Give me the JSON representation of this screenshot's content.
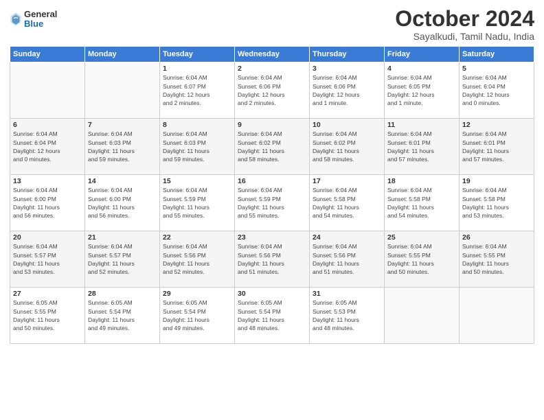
{
  "header": {
    "logo_general": "General",
    "logo_blue": "Blue",
    "month_title": "October 2024",
    "subtitle": "Sayalkudi, Tamil Nadu, India"
  },
  "weekdays": [
    "Sunday",
    "Monday",
    "Tuesday",
    "Wednesday",
    "Thursday",
    "Friday",
    "Saturday"
  ],
  "weeks": [
    [
      {
        "day": "",
        "info": ""
      },
      {
        "day": "",
        "info": ""
      },
      {
        "day": "1",
        "info": "Sunrise: 6:04 AM\nSunset: 6:07 PM\nDaylight: 12 hours\nand 2 minutes."
      },
      {
        "day": "2",
        "info": "Sunrise: 6:04 AM\nSunset: 6:06 PM\nDaylight: 12 hours\nand 2 minutes."
      },
      {
        "day": "3",
        "info": "Sunrise: 6:04 AM\nSunset: 6:06 PM\nDaylight: 12 hours\nand 1 minute."
      },
      {
        "day": "4",
        "info": "Sunrise: 6:04 AM\nSunset: 6:05 PM\nDaylight: 12 hours\nand 1 minute."
      },
      {
        "day": "5",
        "info": "Sunrise: 6:04 AM\nSunset: 6:04 PM\nDaylight: 12 hours\nand 0 minutes."
      }
    ],
    [
      {
        "day": "6",
        "info": "Sunrise: 6:04 AM\nSunset: 6:04 PM\nDaylight: 12 hours\nand 0 minutes."
      },
      {
        "day": "7",
        "info": "Sunrise: 6:04 AM\nSunset: 6:03 PM\nDaylight: 11 hours\nand 59 minutes."
      },
      {
        "day": "8",
        "info": "Sunrise: 6:04 AM\nSunset: 6:03 PM\nDaylight: 11 hours\nand 59 minutes."
      },
      {
        "day": "9",
        "info": "Sunrise: 6:04 AM\nSunset: 6:02 PM\nDaylight: 11 hours\nand 58 minutes."
      },
      {
        "day": "10",
        "info": "Sunrise: 6:04 AM\nSunset: 6:02 PM\nDaylight: 11 hours\nand 58 minutes."
      },
      {
        "day": "11",
        "info": "Sunrise: 6:04 AM\nSunset: 6:01 PM\nDaylight: 11 hours\nand 57 minutes."
      },
      {
        "day": "12",
        "info": "Sunrise: 6:04 AM\nSunset: 6:01 PM\nDaylight: 11 hours\nand 57 minutes."
      }
    ],
    [
      {
        "day": "13",
        "info": "Sunrise: 6:04 AM\nSunset: 6:00 PM\nDaylight: 11 hours\nand 56 minutes."
      },
      {
        "day": "14",
        "info": "Sunrise: 6:04 AM\nSunset: 6:00 PM\nDaylight: 11 hours\nand 56 minutes."
      },
      {
        "day": "15",
        "info": "Sunrise: 6:04 AM\nSunset: 5:59 PM\nDaylight: 11 hours\nand 55 minutes."
      },
      {
        "day": "16",
        "info": "Sunrise: 6:04 AM\nSunset: 5:59 PM\nDaylight: 11 hours\nand 55 minutes."
      },
      {
        "day": "17",
        "info": "Sunrise: 6:04 AM\nSunset: 5:58 PM\nDaylight: 11 hours\nand 54 minutes."
      },
      {
        "day": "18",
        "info": "Sunrise: 6:04 AM\nSunset: 5:58 PM\nDaylight: 11 hours\nand 54 minutes."
      },
      {
        "day": "19",
        "info": "Sunrise: 6:04 AM\nSunset: 5:58 PM\nDaylight: 11 hours\nand 53 minutes."
      }
    ],
    [
      {
        "day": "20",
        "info": "Sunrise: 6:04 AM\nSunset: 5:57 PM\nDaylight: 11 hours\nand 53 minutes."
      },
      {
        "day": "21",
        "info": "Sunrise: 6:04 AM\nSunset: 5:57 PM\nDaylight: 11 hours\nand 52 minutes."
      },
      {
        "day": "22",
        "info": "Sunrise: 6:04 AM\nSunset: 5:56 PM\nDaylight: 11 hours\nand 52 minutes."
      },
      {
        "day": "23",
        "info": "Sunrise: 6:04 AM\nSunset: 5:56 PM\nDaylight: 11 hours\nand 51 minutes."
      },
      {
        "day": "24",
        "info": "Sunrise: 6:04 AM\nSunset: 5:56 PM\nDaylight: 11 hours\nand 51 minutes."
      },
      {
        "day": "25",
        "info": "Sunrise: 6:04 AM\nSunset: 5:55 PM\nDaylight: 11 hours\nand 50 minutes."
      },
      {
        "day": "26",
        "info": "Sunrise: 6:04 AM\nSunset: 5:55 PM\nDaylight: 11 hours\nand 50 minutes."
      }
    ],
    [
      {
        "day": "27",
        "info": "Sunrise: 6:05 AM\nSunset: 5:55 PM\nDaylight: 11 hours\nand 50 minutes."
      },
      {
        "day": "28",
        "info": "Sunrise: 6:05 AM\nSunset: 5:54 PM\nDaylight: 11 hours\nand 49 minutes."
      },
      {
        "day": "29",
        "info": "Sunrise: 6:05 AM\nSunset: 5:54 PM\nDaylight: 11 hours\nand 49 minutes."
      },
      {
        "day": "30",
        "info": "Sunrise: 6:05 AM\nSunset: 5:54 PM\nDaylight: 11 hours\nand 48 minutes."
      },
      {
        "day": "31",
        "info": "Sunrise: 6:05 AM\nSunset: 5:53 PM\nDaylight: 11 hours\nand 48 minutes."
      },
      {
        "day": "",
        "info": ""
      },
      {
        "day": "",
        "info": ""
      }
    ]
  ]
}
